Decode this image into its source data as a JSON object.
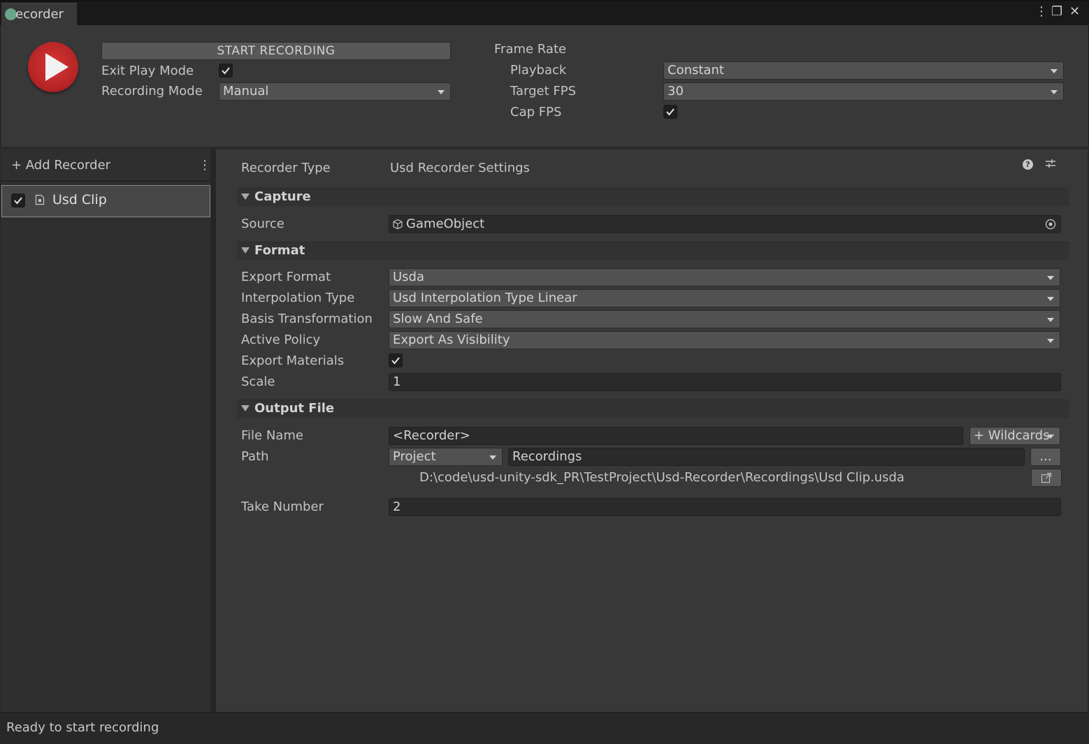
{
  "window": {
    "tab_title": "ecorder",
    "menu_glyph": "⋮",
    "maximize_glyph": "❐",
    "close_glyph": "✕"
  },
  "header": {
    "start_button_label": "START RECORDING",
    "exit_play_mode_label": "Exit Play Mode",
    "exit_play_mode_checked": true,
    "recording_mode_label": "Recording Mode",
    "recording_mode_value": "Manual",
    "frame_rate_label": "Frame Rate",
    "playback_label": "Playback",
    "playback_value": "Constant",
    "target_fps_label": "Target FPS",
    "target_fps_value": "30",
    "cap_fps_label": "Cap FPS",
    "cap_fps_checked": true
  },
  "sidebar": {
    "add_recorder_label": "+ Add Recorder",
    "menu_glyph": "⋮",
    "items": [
      {
        "label": "Usd Clip",
        "enabled": true,
        "selected": true
      }
    ]
  },
  "settings": {
    "recorder_type_label": "Recorder Type",
    "recorder_type_value": "Usd Recorder Settings",
    "help_glyph": "?",
    "preset_glyph": "⇄",
    "capture": {
      "title": "Capture",
      "source_label": "Source",
      "source_value": "GameObject"
    },
    "format": {
      "title": "Format",
      "export_format_label": "Export Format",
      "export_format_value": "Usda",
      "interpolation_type_label": "Interpolation Type",
      "interpolation_type_value": "Usd Interpolation Type Linear",
      "basis_transformation_label": "Basis Transformation",
      "basis_transformation_value": "Slow And Safe",
      "active_policy_label": "Active Policy",
      "active_policy_value": "Export As Visibility",
      "export_materials_label": "Export Materials",
      "export_materials_checked": true,
      "scale_label": "Scale",
      "scale_value": "1"
    },
    "output_file": {
      "title": "Output File",
      "file_name_label": "File Name",
      "file_name_value": "<Recorder>",
      "wildcards_label": "+ Wildcards",
      "path_label": "Path",
      "path_root_value": "Project",
      "path_value": "Recordings",
      "browse_label": "...",
      "full_path": "D:\\code\\usd-unity-sdk_PR\\TestProject\\Usd-Recorder\\Recordings\\Usd Clip.usda",
      "take_number_label": "Take Number",
      "take_number_value": "2"
    }
  },
  "status": {
    "text": "Ready to start recording"
  },
  "colors": {
    "background": "#383838",
    "record_red": "#c02a2a",
    "panel_dark": "#2f2f2f",
    "field_dark": "#2a2a2a",
    "dropdown": "#515151"
  }
}
